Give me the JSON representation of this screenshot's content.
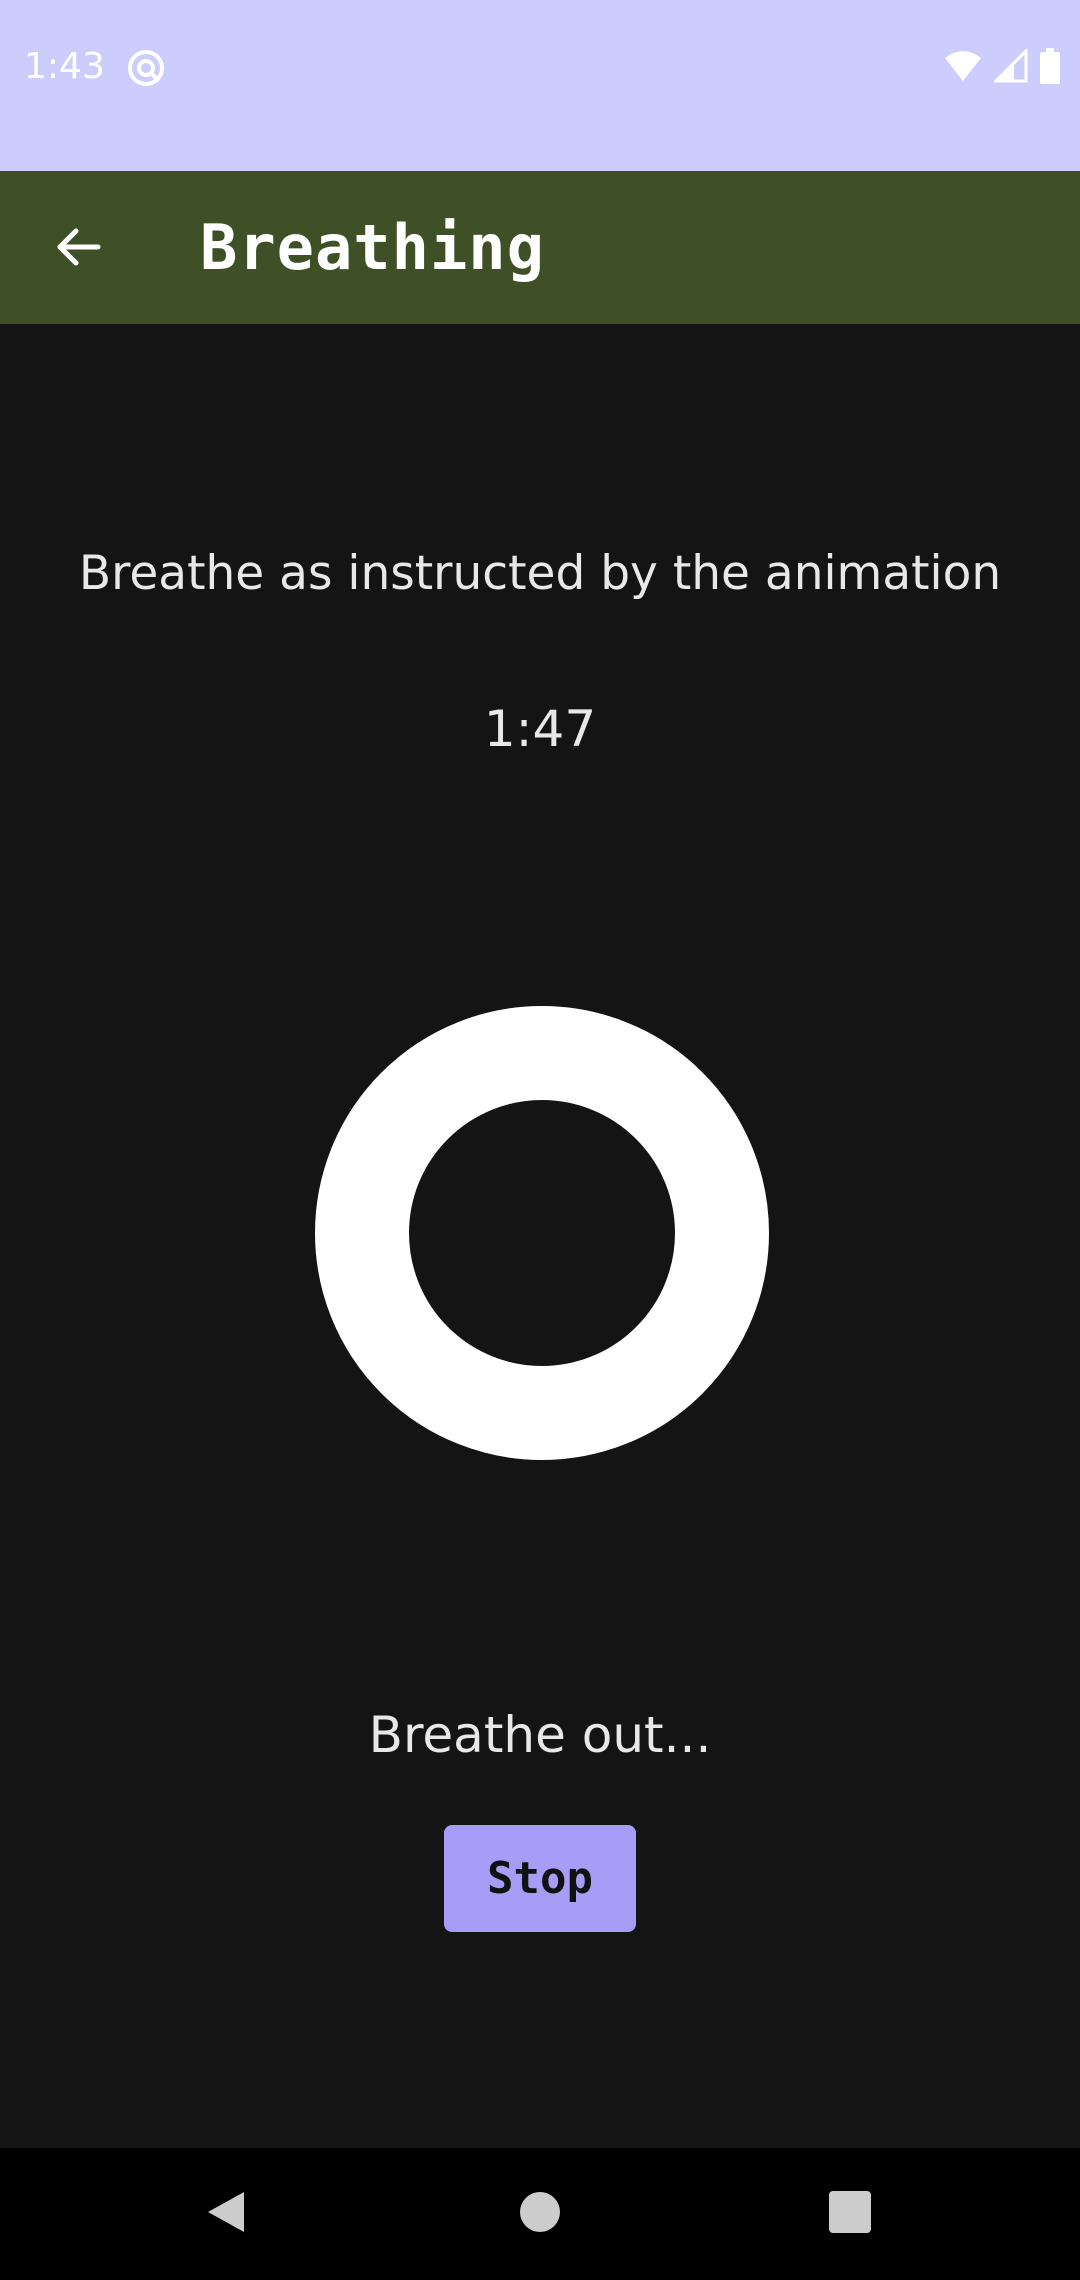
{
  "status_bar": {
    "time": "1:43",
    "icons": [
      "app-notification-icon",
      "wifi-icon",
      "cell-signal-icon",
      "battery-icon"
    ]
  },
  "app_bar": {
    "title": "Breathing",
    "back_icon": "arrow-left-icon"
  },
  "main": {
    "instruction": "Breathe as instructed by the animation",
    "timer": "1:47",
    "phase": "Breathe out...",
    "stop_label": "Stop"
  },
  "nav_bar": {
    "icons": [
      "back-triangle-icon",
      "home-circle-icon",
      "recents-square-icon"
    ]
  },
  "colors": {
    "status_bar_bg": "#cdcdfd",
    "app_bar_bg": "#3f5027",
    "background": "#141414",
    "accent_button": "#a89cf6",
    "ring": "#ffffff"
  }
}
